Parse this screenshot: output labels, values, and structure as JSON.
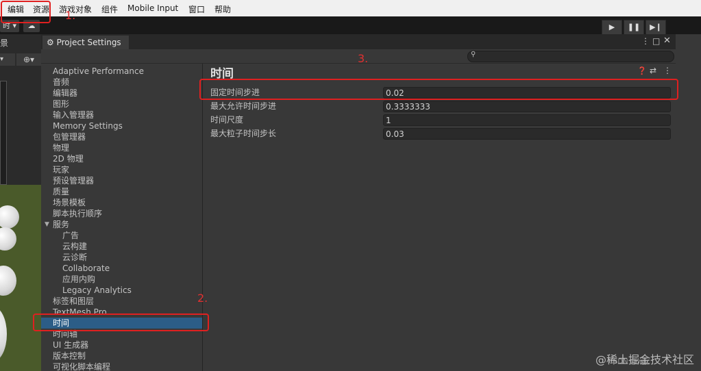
{
  "menubar": {
    "items": [
      "编辑",
      "资源",
      "游戏对象",
      "组件",
      "Mobile Input",
      "窗口",
      "帮助"
    ]
  },
  "toolbar": {
    "left_button_text": "时",
    "left_scene_label": "景"
  },
  "window": {
    "title": "Project Settings",
    "search_placeholder": ""
  },
  "sidebar": {
    "items": [
      {
        "label": "Adaptive Performance"
      },
      {
        "label": "音频"
      },
      {
        "label": "编辑器"
      },
      {
        "label": "图形"
      },
      {
        "label": "输入管理器"
      },
      {
        "label": "Memory Settings"
      },
      {
        "label": "包管理器"
      },
      {
        "label": "物理"
      },
      {
        "label": "2D 物理"
      },
      {
        "label": "玩家"
      },
      {
        "label": "预设管理器"
      },
      {
        "label": "质量"
      },
      {
        "label": "场景模板"
      },
      {
        "label": "脚本执行顺序"
      },
      {
        "label": "服务"
      },
      {
        "label": "广告"
      },
      {
        "label": "云构建"
      },
      {
        "label": "云诊断"
      },
      {
        "label": "Collaborate"
      },
      {
        "label": "应用内购"
      },
      {
        "label": "Legacy Analytics"
      },
      {
        "label": "标签和图层"
      },
      {
        "label": "TextMesh Pro"
      },
      {
        "label": "时间"
      },
      {
        "label": "时间轴"
      },
      {
        "label": "UI 生成器"
      },
      {
        "label": "版本控制"
      },
      {
        "label": "可视化脚本编程"
      }
    ],
    "selected": "时间"
  },
  "content": {
    "title": "时间",
    "properties": [
      {
        "label": "固定时间步进",
        "value": "0.02"
      },
      {
        "label": "最大允许时间步进",
        "value": "0.3333333"
      },
      {
        "label": "时间尺度",
        "value": "1"
      },
      {
        "label": "最大粒子时间步长",
        "value": "0.03"
      }
    ]
  },
  "annotations": {
    "step1": "1.",
    "step2": "2.",
    "step3": "3."
  },
  "watermark": "@稀土掘金技术社区",
  "watermark_small": "CSDN @wjjc"
}
